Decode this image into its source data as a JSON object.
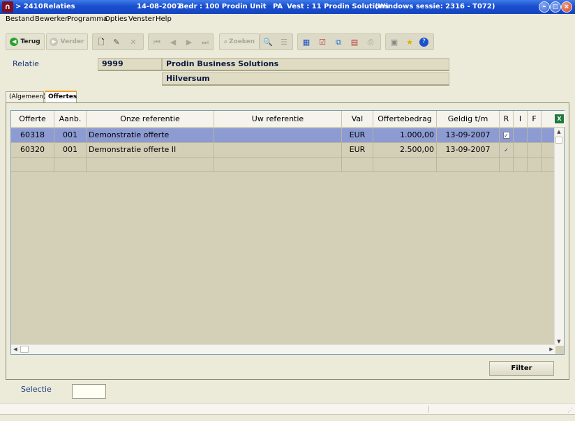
{
  "window": {
    "code": "> 2410",
    "title": "Relaties",
    "date": "14-08-2007",
    "company": "Bedr : 100 Prodin Unit",
    "user": "PA",
    "branch": "Vest : 11 Prodin Solutions",
    "session": "(Windows sessie: 2316 - T072)"
  },
  "menu": [
    "Bestand",
    "Bewerken",
    "Programma",
    "Opties",
    "Venster",
    "Help"
  ],
  "toolbar": {
    "back_label": "Terug",
    "forward_label": "Verder",
    "search_label": "Zoeken"
  },
  "relation": {
    "label": "Relatie",
    "number": "9999",
    "name": "Prodin Business Solutions",
    "city": "Hilversum"
  },
  "tabs": [
    "(Algemeen)",
    "Offertes"
  ],
  "grid": {
    "columns": [
      "Offerte",
      "Aanb.",
      "Onze referentie",
      "Uw referentie",
      "Val",
      "Offertebedrag",
      "Geldig t/m",
      "R",
      "I",
      "F"
    ],
    "rows": [
      {
        "offerte": "60318",
        "aanb": "001",
        "onze_ref": "Demonstratie offerte",
        "uw_ref": "",
        "val": "EUR",
        "bedrag": "1.000,00",
        "geldig": "13-09-2007",
        "r": "✓"
      },
      {
        "offerte": "60320",
        "aanb": "001",
        "onze_ref": "Demonstratie offerte II",
        "uw_ref": "",
        "val": "EUR",
        "bedrag": "2.500,00",
        "geldig": "13-09-2007",
        "r": "✓"
      }
    ]
  },
  "filter_label": "Filter",
  "selection_label": "Selectie",
  "colors": {
    "titlebar": "#1a4fcf",
    "selected_row": "#8d9bd3",
    "background": "#ecead8"
  }
}
